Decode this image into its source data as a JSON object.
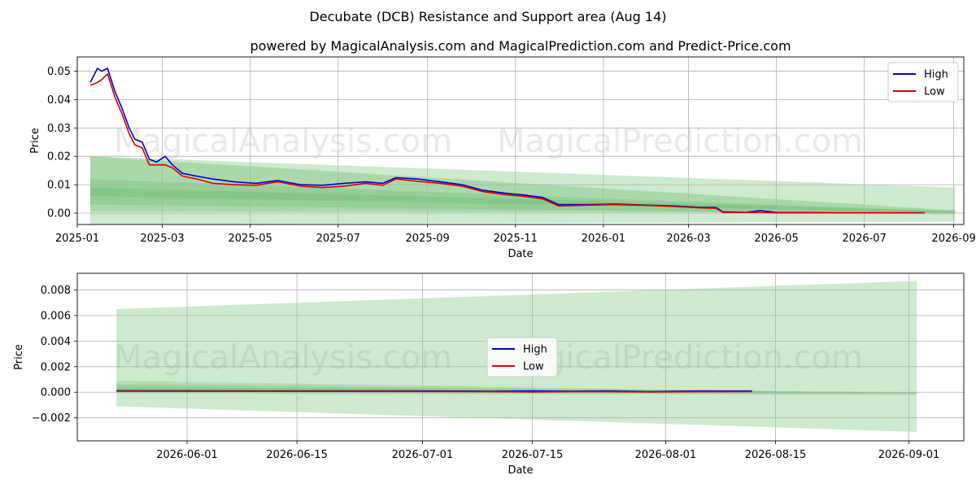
{
  "title": "Decubate (DCB) Resistance and Support area (Aug 14)",
  "subtitle": "powered by MagicalAnalysis.com and MagicalPrediction.com and Predict-Price.com",
  "watermarks": [
    "MagicalAnalysis.com",
    "MagicalPrediction.com"
  ],
  "colors": {
    "high": "#0000cc",
    "low": "#dd0000",
    "band": "#4caf50",
    "grid": "#b0b0b0"
  },
  "chart_data": [
    {
      "type": "line",
      "xlabel": "Date",
      "ylabel": "Price",
      "xlim": [
        "2025-01-01",
        "2026-09-08"
      ],
      "ylim": [
        -0.004,
        0.055
      ],
      "xticks": [
        "2025-01",
        "2025-03",
        "2025-05",
        "2025-07",
        "2025-09",
        "2025-11",
        "2026-01",
        "2026-03",
        "2026-05",
        "2026-07",
        "2026-09"
      ],
      "yticks": [
        0.0,
        0.01,
        0.02,
        0.03,
        0.04,
        0.05
      ],
      "ytick_labels": [
        "0.00",
        "0.01",
        "0.02",
        "0.03",
        "0.04",
        "0.05"
      ],
      "grid": true,
      "legend": {
        "position": "upper right",
        "entries": [
          "High",
          "Low"
        ]
      },
      "series": [
        {
          "name": "High",
          "x": [
            "2025-01-10",
            "2025-01-15",
            "2025-01-18",
            "2025-01-22",
            "2025-01-27",
            "2025-02-01",
            "2025-02-06",
            "2025-02-10",
            "2025-02-15",
            "2025-02-20",
            "2025-02-25",
            "2025-03-03",
            "2025-03-08",
            "2025-03-15",
            "2025-03-25",
            "2025-04-05",
            "2025-04-20",
            "2025-05-05",
            "2025-05-20",
            "2025-06-05",
            "2025-06-20",
            "2025-07-05",
            "2025-07-20",
            "2025-08-01",
            "2025-08-10",
            "2025-08-25",
            "2025-09-10",
            "2025-09-25",
            "2025-10-10",
            "2025-10-25",
            "2025-11-05",
            "2025-11-20",
            "2025-12-01",
            "2025-12-20",
            "2026-01-10",
            "2026-02-01",
            "2026-02-20",
            "2026-03-10",
            "2026-03-20",
            "2026-03-25",
            "2026-04-10",
            "2026-04-20",
            "2026-05-01",
            "2026-05-20",
            "2026-06-10",
            "2026-07-01",
            "2026-07-20",
            "2026-08-12"
          ],
          "values": [
            0.046,
            0.051,
            0.05,
            0.051,
            0.043,
            0.037,
            0.03,
            0.026,
            0.025,
            0.019,
            0.018,
            0.02,
            0.017,
            0.014,
            0.013,
            0.012,
            0.011,
            0.0105,
            0.0115,
            0.01,
            0.0098,
            0.0105,
            0.011,
            0.0105,
            0.0125,
            0.012,
            0.011,
            0.01,
            0.008,
            0.007,
            0.0065,
            0.0055,
            0.003,
            0.003,
            0.0032,
            0.0028,
            0.0025,
            0.002,
            0.002,
            0.0004,
            0.0003,
            0.0009,
            0.0002,
            0.0002,
            0.0001,
            0.0001,
            0.0001,
            0.0001
          ]
        },
        {
          "name": "Low",
          "x": [
            "2025-01-10",
            "2025-01-15",
            "2025-01-18",
            "2025-01-22",
            "2025-01-27",
            "2025-02-01",
            "2025-02-06",
            "2025-02-10",
            "2025-02-15",
            "2025-02-20",
            "2025-02-25",
            "2025-03-03",
            "2025-03-08",
            "2025-03-15",
            "2025-03-25",
            "2025-04-05",
            "2025-04-20",
            "2025-05-05",
            "2025-05-20",
            "2025-06-05",
            "2025-06-20",
            "2025-07-05",
            "2025-07-20",
            "2025-08-01",
            "2025-08-10",
            "2025-08-25",
            "2025-09-10",
            "2025-09-25",
            "2025-10-10",
            "2025-10-25",
            "2025-11-05",
            "2025-11-20",
            "2025-12-01",
            "2025-12-20",
            "2026-01-10",
            "2026-02-01",
            "2026-02-20",
            "2026-03-10",
            "2026-03-20",
            "2026-03-25",
            "2026-04-10",
            "2026-04-20",
            "2026-05-01",
            "2026-05-20",
            "2026-06-10",
            "2026-07-01",
            "2026-07-20",
            "2026-08-12"
          ],
          "values": [
            0.045,
            0.046,
            0.047,
            0.049,
            0.041,
            0.035,
            0.028,
            0.024,
            0.023,
            0.017,
            0.017,
            0.017,
            0.016,
            0.013,
            0.012,
            0.0105,
            0.01,
            0.0098,
            0.011,
            0.0095,
            0.009,
            0.0095,
            0.0105,
            0.0098,
            0.012,
            0.0112,
            0.0105,
            0.0095,
            0.0075,
            0.0065,
            0.006,
            0.005,
            0.0025,
            0.0028,
            0.003,
            0.0027,
            0.0023,
            0.0018,
            0.0017,
            0.0002,
            0.0002,
            0.0002,
            0.0001,
            0.0001,
            0.0001,
            0.0001,
            0.0001,
            0.0001
          ]
        }
      ],
      "bands": [
        {
          "x": [
            "2025-01-10",
            "2026-09-02"
          ],
          "upper": [
            0.02,
            0.009
          ],
          "lower": [
            -0.004,
            -0.003
          ],
          "opacity": 0.28
        },
        {
          "x": [
            "2025-01-10",
            "2026-09-02"
          ],
          "upper": [
            0.02,
            0.001
          ],
          "lower": [
            0.0005,
            0.0002
          ],
          "opacity": 0.28
        },
        {
          "x": [
            "2025-01-10",
            "2026-09-02"
          ],
          "upper": [
            0.012,
            0.0005
          ],
          "lower": [
            0.003,
            -0.0005
          ],
          "opacity": 0.22
        },
        {
          "x": [
            "2025-01-10",
            "2026-09-02"
          ],
          "upper": [
            0.009,
            0.0008
          ],
          "lower": [
            0.006,
            0.0001
          ],
          "opacity": 0.22
        }
      ]
    },
    {
      "type": "line",
      "xlabel": "Date",
      "ylabel": "Price",
      "xlim": [
        "2026-05-18",
        "2026-09-08"
      ],
      "ylim": [
        -0.0038,
        0.0093
      ],
      "xticks": [
        "2026-06-01",
        "2026-06-15",
        "2026-07-01",
        "2026-07-15",
        "2026-08-01",
        "2026-08-15",
        "2026-09-01"
      ],
      "yticks": [
        -0.002,
        0.0,
        0.002,
        0.004,
        0.006,
        0.008
      ],
      "ytick_labels": [
        "−0.002",
        "0.000",
        "0.002",
        "0.004",
        "0.006",
        "0.008"
      ],
      "grid": true,
      "legend": {
        "position": "center",
        "entries": [
          "High",
          "Low"
        ]
      },
      "series": [
        {
          "name": "High",
          "x": [
            "2026-05-23",
            "2026-06-10",
            "2026-07-01",
            "2026-07-10",
            "2026-07-15",
            "2026-07-20",
            "2026-07-25",
            "2026-07-30",
            "2026-08-05",
            "2026-08-12"
          ],
          "values": [
            0.00012,
            0.0001,
            0.0001,
            8e-05,
            0.0001,
            8e-05,
            0.0001,
            5e-05,
            0.0001,
            0.0001
          ]
        },
        {
          "name": "Low",
          "x": [
            "2026-05-23",
            "2026-06-10",
            "2026-07-01",
            "2026-07-10",
            "2026-07-15",
            "2026-07-20",
            "2026-07-25",
            "2026-07-30",
            "2026-08-05",
            "2026-08-12"
          ],
          "values": [
            8e-05,
            7e-05,
            6e-05,
            4e-05,
            2e-05,
            4e-05,
            4e-05,
            2e-05,
            4e-05,
            5e-05
          ]
        }
      ],
      "bands": [
        {
          "x": [
            "2026-05-23",
            "2026-09-02"
          ],
          "upper": [
            0.0065,
            0.0087
          ],
          "lower": [
            -0.0011,
            -0.0031
          ],
          "opacity": 0.28
        },
        {
          "x": [
            "2026-05-23",
            "2026-09-02"
          ],
          "upper": [
            0.0009,
            -0.0001
          ],
          "lower": [
            0.0001,
            -0.0001
          ],
          "opacity": 0.22
        },
        {
          "x": [
            "2026-05-23",
            "2026-09-02"
          ],
          "upper": [
            0.0006,
            0.0
          ],
          "lower": [
            -0.0001,
            -0.0002
          ],
          "opacity": 0.22
        },
        {
          "x": [
            "2026-05-23",
            "2026-09-02"
          ],
          "upper": [
            0.0004,
            0.0
          ],
          "lower": [
            0.0,
            -0.0001
          ],
          "opacity": 0.22
        }
      ]
    }
  ]
}
